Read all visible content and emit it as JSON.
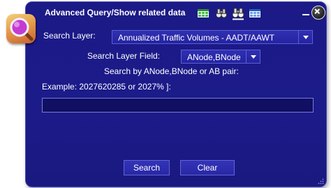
{
  "window": {
    "title": "Advanced Query/Show related data"
  },
  "toolbar": {
    "icons": [
      "table-green-icon",
      "binoculars-icon",
      "binoculars-selected-icon",
      "table-blue-icon"
    ],
    "minimize_icon": "minimize-icon",
    "close_icon": "close-x-icon"
  },
  "logo": {
    "icon": "magnifier-icon",
    "colors": {
      "outer": "#e8a14e",
      "lens": "#c43bd0"
    }
  },
  "form": {
    "search_layer": {
      "label": "Search Layer:",
      "value": "Annualized Traffic Volumes - AADT/AAWT"
    },
    "search_layer_field": {
      "label": "Search Layer Field:",
      "value": "ANode,BNode"
    },
    "hint": "Search by ANode,BNode or AB pair:",
    "example": "Example: 2027620285 or 2027% ]:",
    "query_input": {
      "value": "",
      "placeholder": ""
    }
  },
  "buttons": {
    "search": "Search",
    "clear": "Clear"
  },
  "colors": {
    "panel_background": "#1b1a86",
    "control_background": "#2828a6",
    "input_background": "#100f63",
    "border": "#5e5ed0",
    "text": "#ffffff"
  }
}
